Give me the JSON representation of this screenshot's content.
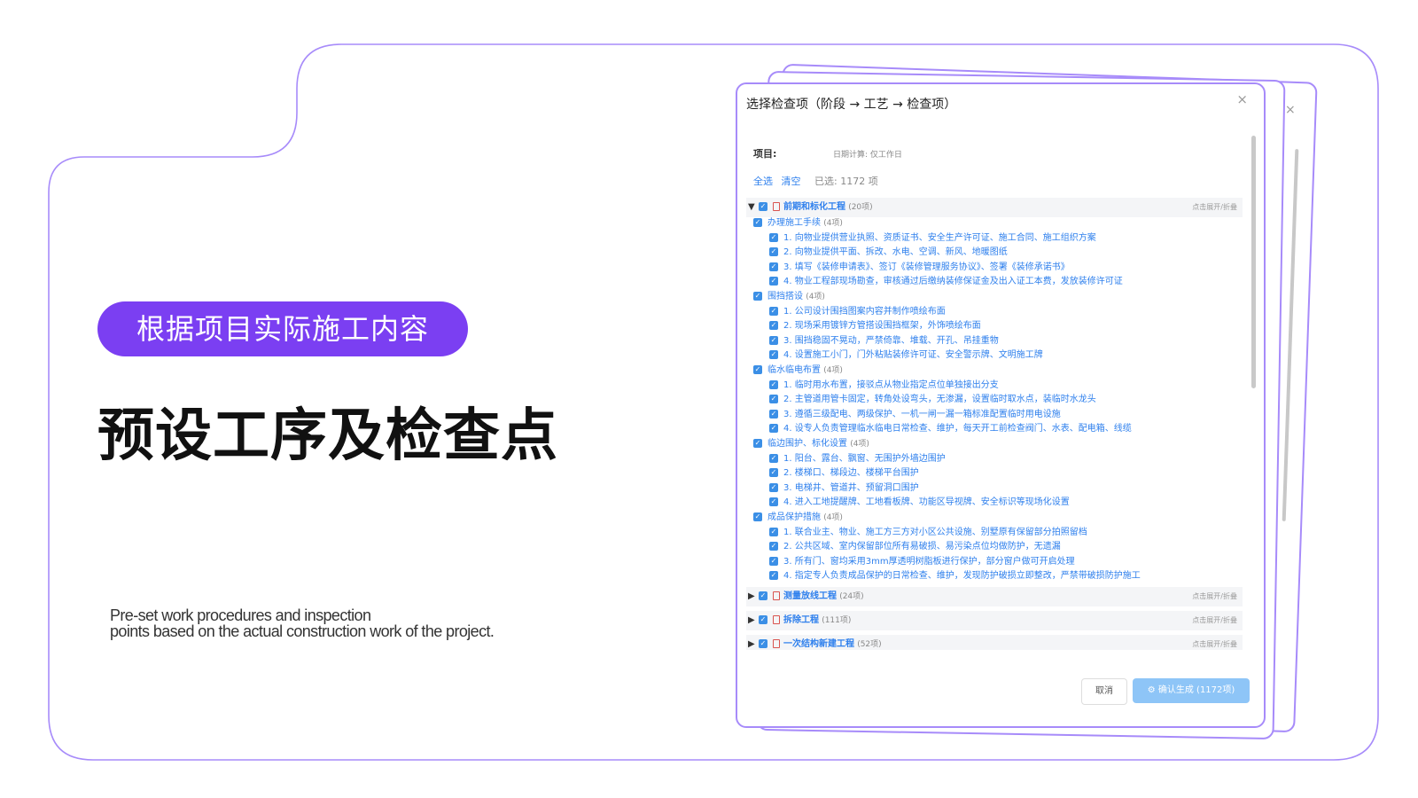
{
  "slide": {
    "pill": "根据项目实际施工内容",
    "headline": "预设工序及检查点",
    "subtitle_line1": "Pre-set work procedures and inspection",
    "subtitle_line2": "points based on the actual construction work of the project.",
    "accent_color": "#7b3ff2",
    "outline_color": "#a78bfa"
  },
  "dialog": {
    "title": "选择检查项（阶段 → 工艺 → 检查项）",
    "close_icon": "×",
    "project_label": "项目:",
    "project_value": "日期计算: 仅工作日",
    "select_all": "全选",
    "clear": "清空",
    "selected": "已选: 1172 项",
    "expand_hint": "点击展开/折叠",
    "cancel": "取消",
    "confirm": "确认生成 (1172项)",
    "stages": [
      {
        "name": "前期和标化工程",
        "count": "(20项)",
        "expanded": true
      },
      {
        "name": "测量放线工程",
        "count": "(24项)",
        "expanded": false
      },
      {
        "name": "拆除工程",
        "count": "(111项)",
        "expanded": false
      },
      {
        "name": "一次结构新建工程",
        "count": "(52项)",
        "expanded": false
      }
    ],
    "groups": [
      {
        "name": "办理施工手续",
        "count": "(4项)",
        "items": [
          "1. 向物业提供营业执照、资质证书、安全生产许可证、施工合同、施工组织方案",
          "2. 向物业提供平面、拆改、水电、空调、新风、地暖图纸",
          "3. 填写《装修申请表》、签订《装修管理服务协议》、签署《装修承诺书》",
          "4. 物业工程部现场勘查，审核通过后缴纳装修保证金及出入证工本费，发放装修许可证"
        ]
      },
      {
        "name": "围挡搭设",
        "count": "(4项)",
        "items": [
          "1. 公司设计围挡图案内容并制作喷绘布面",
          "2. 现场采用镀锌方管搭设围挡框架，外饰喷绘布面",
          "3. 围挡稳固不晃动，严禁倚靠、堆载、开孔、吊挂重物",
          "4. 设置施工小门，门外粘贴装修许可证、安全警示牌、文明施工牌"
        ]
      },
      {
        "name": "临水临电布置",
        "count": "(4项)",
        "items": [
          "1. 临时用水布置，接驳点从物业指定点位单独接出分支",
          "2. 主管道用管卡固定，转角处设弯头，无渗漏，设置临时取水点，装临时水龙头",
          "3. 遵循三级配电、两级保护、一机一闸一漏一箱标准配置临时用电设施",
          "4. 设专人负责管理临水临电日常检查、维护，每天开工前检查阀门、水表、配电箱、线缆"
        ]
      },
      {
        "name": "临边围护、标化设置",
        "count": "(4项)",
        "items": [
          "1. 阳台、露台、飘窗、无围护外墙边围护",
          "2. 楼梯口、梯段边、楼梯平台围护",
          "3. 电梯井、管道井、预留洞口围护",
          "4. 进入工地提醒牌、工地看板牌、功能区导视牌、安全标识等现场化设置"
        ]
      },
      {
        "name": "成品保护措施",
        "count": "(4项)",
        "items": [
          "1. 联合业主、物业、施工方三方对小区公共设施、别墅原有保留部分拍照留档",
          "2. 公共区域、室内保留部位所有易破损、易污染点位均做防护，无遗漏",
          "3. 所有门、窗均采用3mm厚透明树脂板进行保护，部分窗户做可开启处理",
          "4. 指定专人负责成品保护的日常检查、维护，发现防护破损立即整改，严禁带破损防护施工"
        ]
      }
    ]
  }
}
